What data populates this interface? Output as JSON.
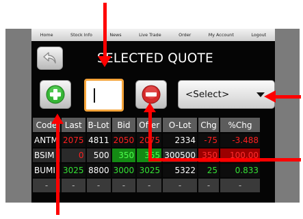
{
  "nav": [
    "Home",
    "Stock Info",
    "News",
    "Live Trade",
    "Order",
    "My Account",
    "Logout"
  ],
  "title": "SELECTED QUOTE",
  "input": {
    "value": ""
  },
  "select": {
    "value": "<Select>"
  },
  "table": {
    "headers": [
      "Code",
      "Last",
      "B-Lot",
      "Bid",
      "Offer",
      "O-Lot",
      "Chg",
      "%Chg"
    ],
    "rows": [
      [
        "ANTM",
        "2075",
        "4811",
        "2050",
        "2075",
        "2334",
        "-75",
        "-3.488"
      ],
      [
        "BSIM",
        "0",
        "500",
        "350",
        "355",
        "300500",
        "350",
        "100.00"
      ],
      [
        "BUMI",
        "3025",
        "8800",
        "3000",
        "3025",
        "5322",
        "25",
        "0.833"
      ],
      [
        "-",
        "-",
        "-",
        "-",
        "-",
        "-",
        "-",
        "-"
      ]
    ]
  },
  "colors": {
    "accent": "#f5a43a",
    "up": "#34e334",
    "down": "#ff2020",
    "annotation": "#ff0000"
  },
  "icons": [
    "back-arrow-icon",
    "plus-icon",
    "minus-icon",
    "chevron-down-icon"
  ]
}
